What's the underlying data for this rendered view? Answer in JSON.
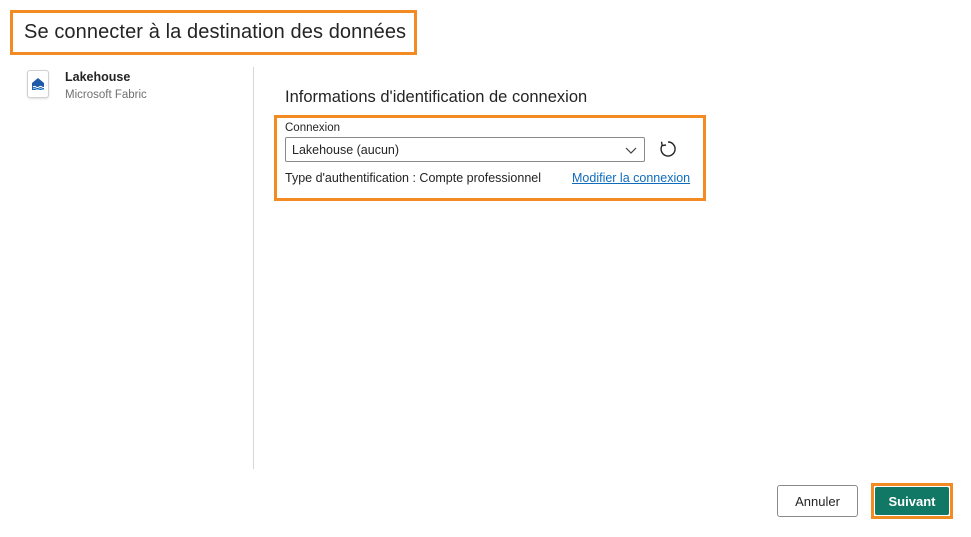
{
  "dialog": {
    "title": "Se connecter à la destination des données"
  },
  "source": {
    "name": "Lakehouse",
    "subtitle": "Microsoft Fabric",
    "icon": "lakehouse-icon"
  },
  "credentials": {
    "heading": "Informations d'identification de connexion",
    "connection_label": "Connexion",
    "connection_value": "Lakehouse (aucun)",
    "auth_type_text": "Type d'authentification : Compte professionnel",
    "edit_link": "Modifier la connexion"
  },
  "footer": {
    "cancel_label": "Annuler",
    "next_label": "Suivant"
  },
  "colors": {
    "highlight": "#f28c22",
    "primary_button": "#117865",
    "link": "#0f6cbd"
  }
}
